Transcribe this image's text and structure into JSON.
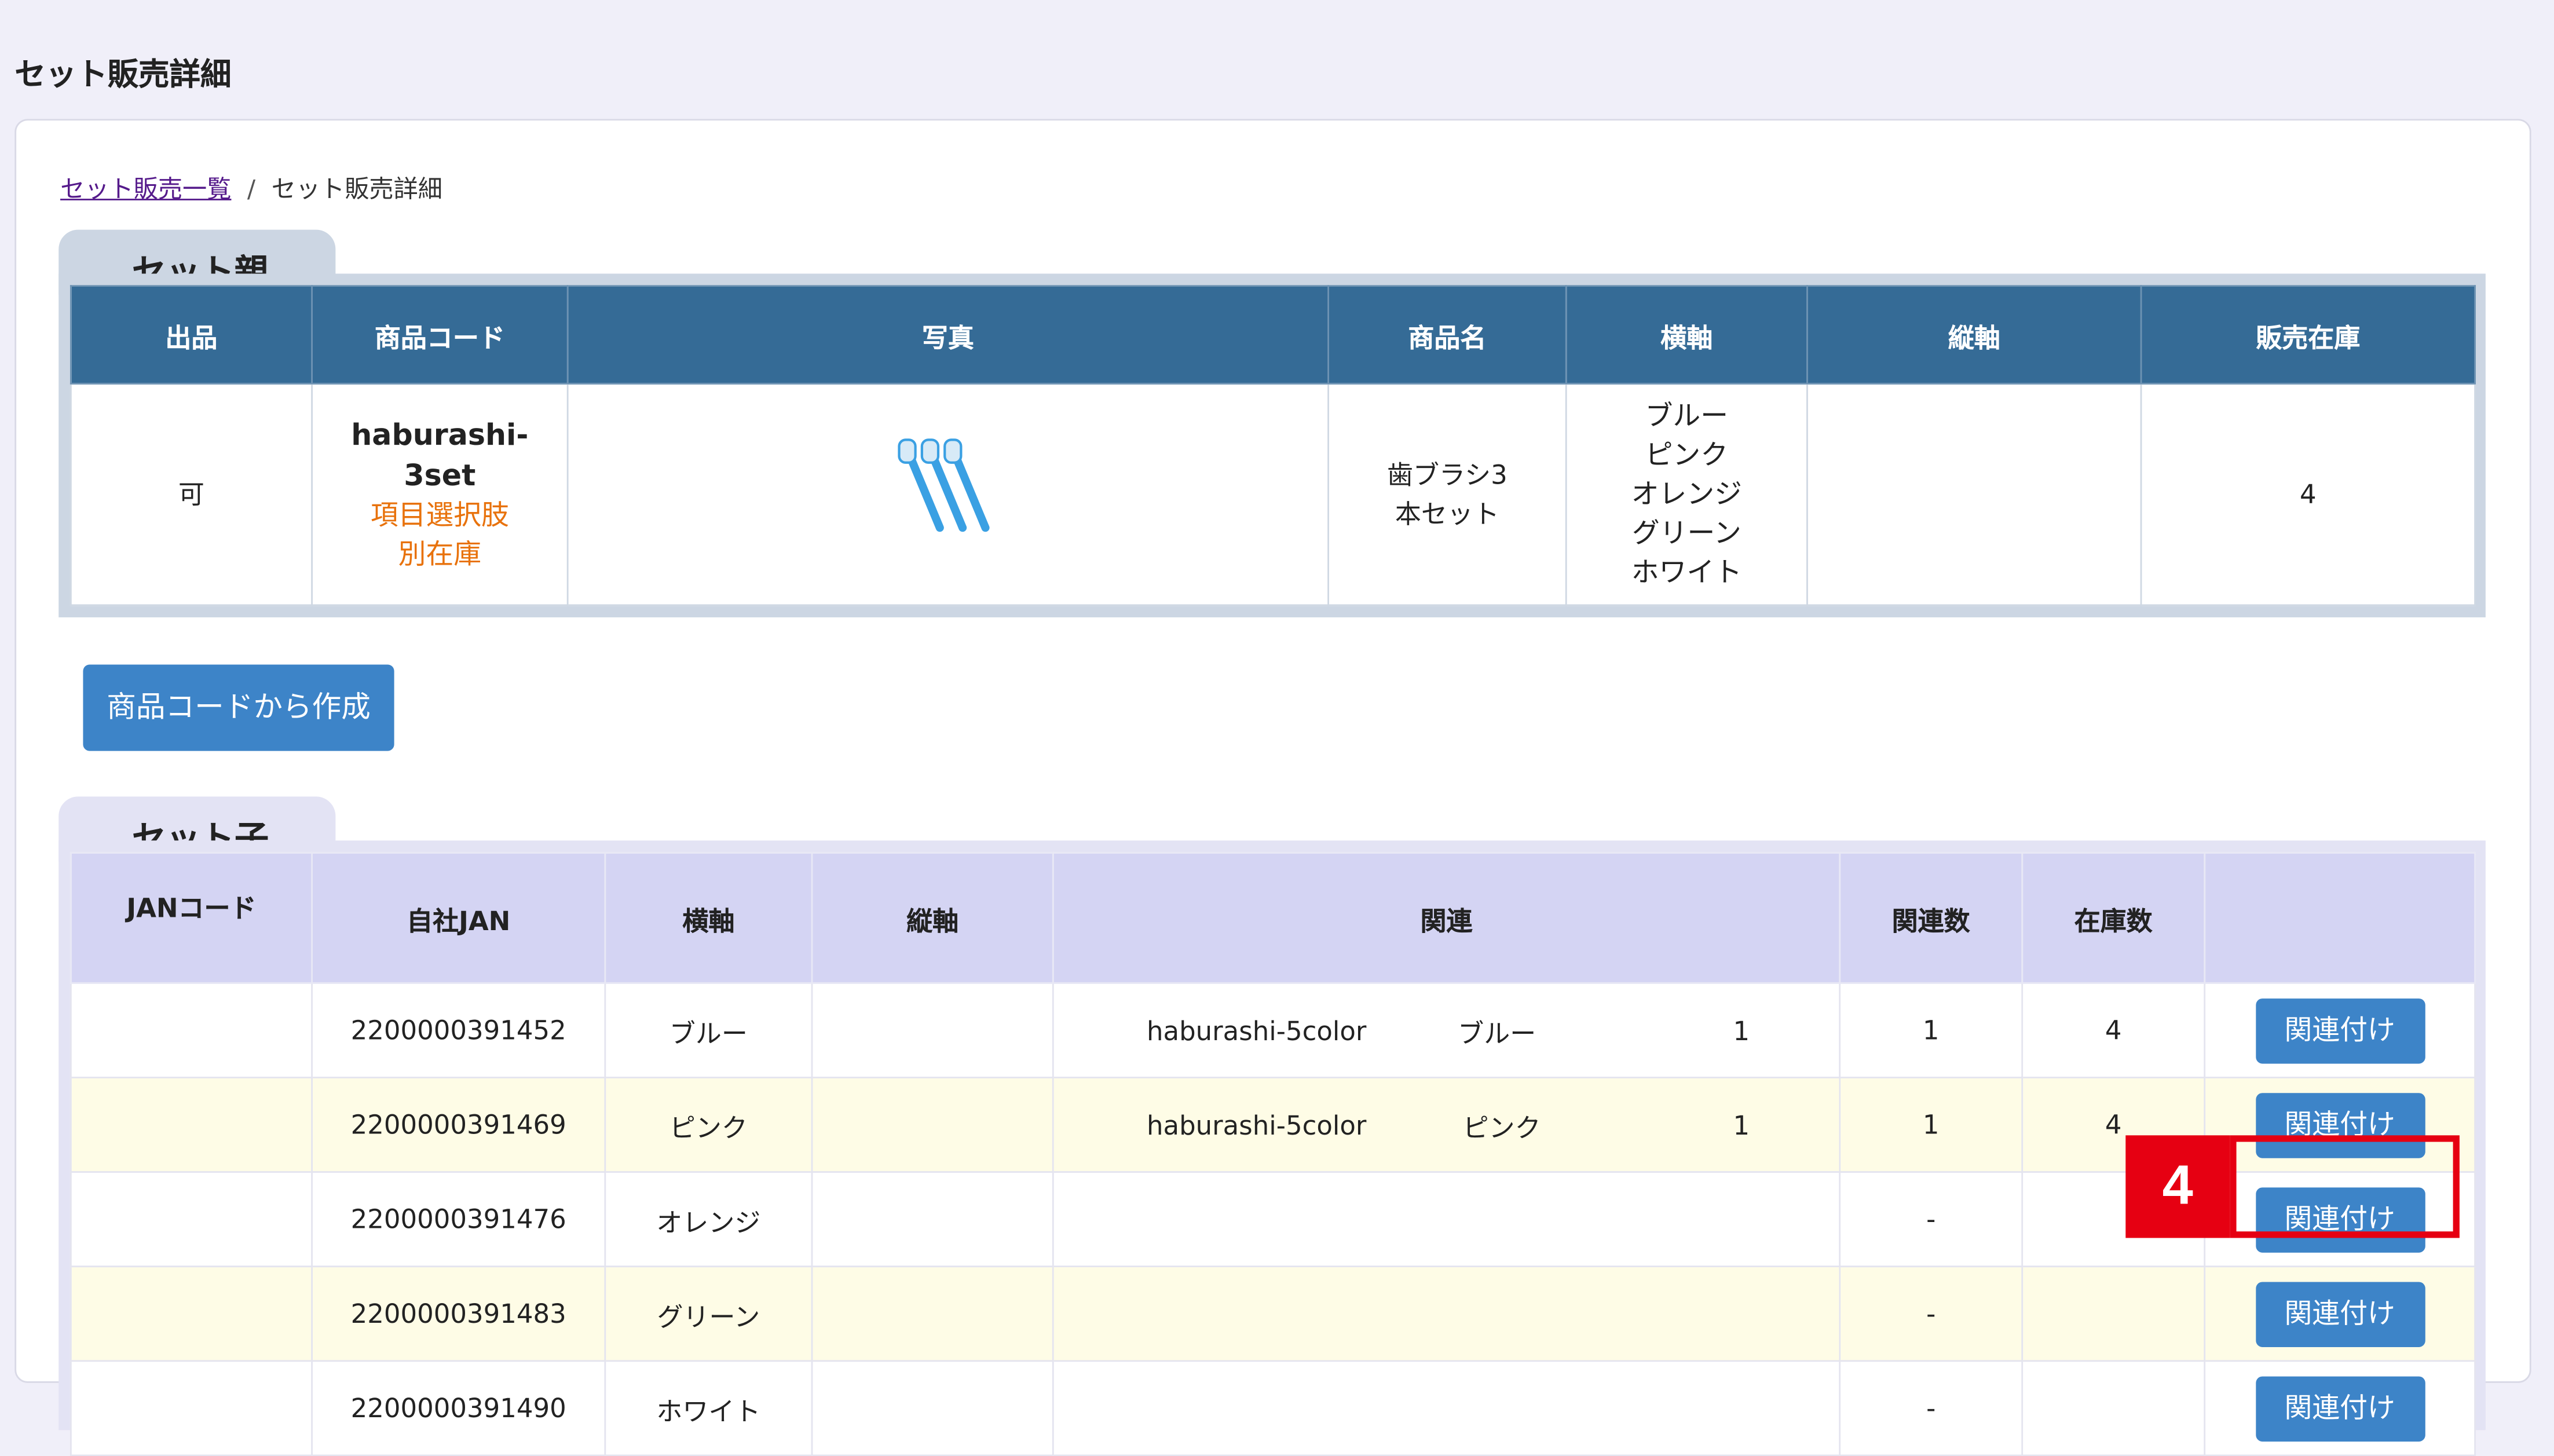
{
  "page_title": "セット販売詳細",
  "breadcrumb": {
    "link": "セット販売一覧",
    "separator": "/",
    "current": "セット販売詳細"
  },
  "parent": {
    "tab_label": "セット親",
    "headers": [
      "出品",
      "商品コード",
      "写真",
      "商品名",
      "横軸",
      "縦軸",
      "販売在庫"
    ],
    "row": {
      "listing": "可",
      "code_lines": [
        "haburashi-",
        "3set"
      ],
      "code_note_lines": [
        "項目選択肢",
        "別在庫"
      ],
      "photo_icon": "toothbrush-icon",
      "name_lines": [
        "歯ブラシ3",
        "本セット"
      ],
      "axis_h": [
        "ブルー",
        "ピンク",
        "オレンジ",
        "グリーン",
        "ホワイト"
      ],
      "axis_v": "",
      "stock": "4"
    }
  },
  "create_button": "商品コードから作成",
  "child": {
    "tab_label": "セット子",
    "headers": [
      "JANコード",
      "自社JAN",
      "横軸",
      "縦軸",
      "関連",
      "関連数",
      "在庫数",
      ""
    ],
    "link_button": "関連付け",
    "rows": [
      {
        "jan": "",
        "own_jan": "2200000391452",
        "h": "ブルー",
        "v": "",
        "rel_code": "haburashi-5color",
        "rel_axis": "ブルー",
        "rel_qty": "1",
        "count": "1",
        "stock": "4"
      },
      {
        "jan": "",
        "own_jan": "2200000391469",
        "h": "ピンク",
        "v": "",
        "rel_code": "haburashi-5color",
        "rel_axis": "ピンク",
        "rel_qty": "1",
        "count": "1",
        "stock": "4"
      },
      {
        "jan": "",
        "own_jan": "2200000391476",
        "h": "オレンジ",
        "v": "",
        "rel_code": "",
        "rel_axis": "",
        "rel_qty": "",
        "count": "-",
        "stock": ""
      },
      {
        "jan": "",
        "own_jan": "2200000391483",
        "h": "グリーン",
        "v": "",
        "rel_code": "",
        "rel_axis": "",
        "rel_qty": "",
        "count": "-",
        "stock": ""
      },
      {
        "jan": "",
        "own_jan": "2200000391490",
        "h": "ホワイト",
        "v": "",
        "rel_code": "",
        "rel_axis": "",
        "rel_qty": "",
        "count": "-",
        "stock": ""
      }
    ]
  },
  "callout": {
    "number": "4",
    "color": "#e60012"
  }
}
